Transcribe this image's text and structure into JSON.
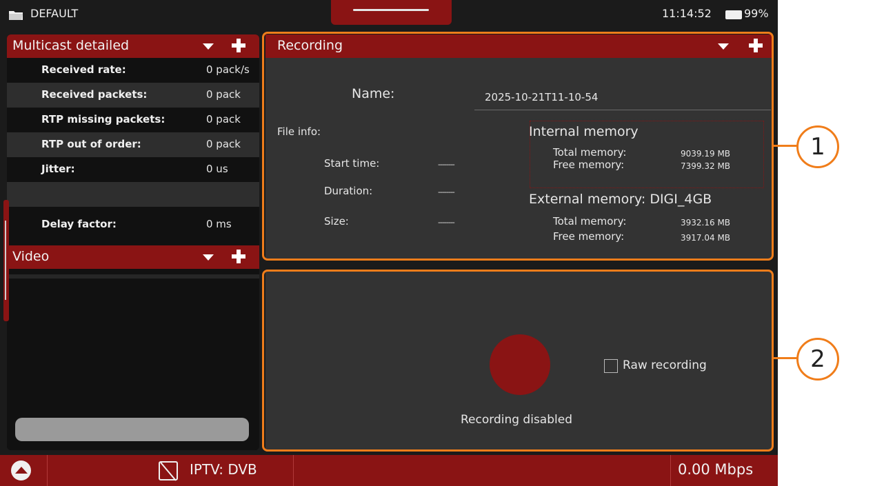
{
  "status_bar": {
    "profile_name": "DEFAULT",
    "clock": "11:14:52",
    "battery": "99%"
  },
  "multicast_panel": {
    "title": "Multicast detailed",
    "rows": [
      {
        "label": "Received rate:",
        "value": "0 pack/s"
      },
      {
        "label": "Received packets:",
        "value": "0 pack"
      },
      {
        "label": "RTP missing packets:",
        "value": "0 pack"
      },
      {
        "label": "RTP out of order:",
        "value": "0 pack"
      },
      {
        "label": "Jitter:",
        "value": "0 us"
      },
      {
        "label": "",
        "value": ""
      },
      {
        "label": "Delay factor:",
        "value": "0 ms"
      }
    ]
  },
  "video_panel": {
    "title": "Video"
  },
  "recording_panel": {
    "title": "Recording",
    "name_label": "Name:",
    "name_value": "2025-10-21T11-10-54",
    "file_info_label": "File info:",
    "file_info": [
      {
        "label": "Start time:",
        "value": "--------"
      },
      {
        "label": "Duration:",
        "value": "--------"
      },
      {
        "label": "Size:",
        "value": "--------"
      }
    ],
    "internal_memory": {
      "title": "Internal memory",
      "total_label": "Total memory:",
      "total_value": "9039.19 MB",
      "free_label": "Free memory:",
      "free_value": "7399.32 MB"
    },
    "external_memory": {
      "title": "External memory: DIGI_4GB",
      "total_label": "Total memory:",
      "total_value": "3932.16 MB",
      "free_label": "Free memory:",
      "free_value": "3917.04 MB"
    }
  },
  "control_panel": {
    "raw_recording_label": "Raw recording",
    "raw_recording_checked": false,
    "status_text": "Recording disabled"
  },
  "bottom_bar": {
    "source": "IPTV: DVB",
    "rate": "0.00 Mbps"
  },
  "callouts": {
    "one": "1",
    "two": "2"
  },
  "colors": {
    "accent_red": "#8a1414",
    "callout_orange": "#f07d1a",
    "panel_gray": "#333333",
    "background": "#1b1b1b"
  }
}
